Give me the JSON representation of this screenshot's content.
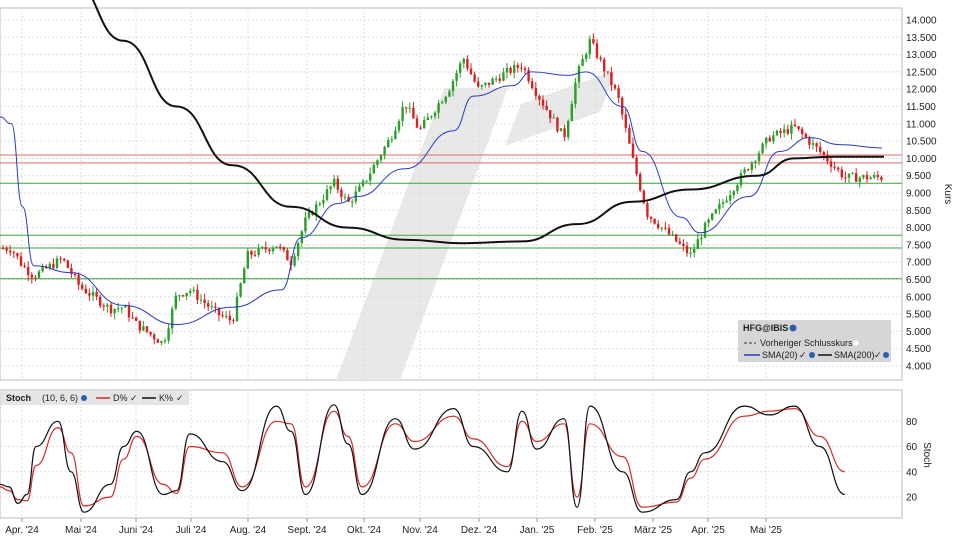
{
  "chart_data": [
    {
      "type": "candlestick",
      "instrument": "HFG@IBIS",
      "ylabel": "Kurs",
      "ylim": [
        4000,
        14000
      ],
      "yticks": [
        "14.000",
        "13.500",
        "13.000",
        "12.500",
        "12.000",
        "11.500",
        "11.000",
        "10.500",
        "10.000",
        "9.500",
        "9.000",
        "8.500",
        "8.000",
        "7.500",
        "7.000",
        "6.500",
        "6.000",
        "5.500",
        "5.000",
        "4.500",
        "4.000"
      ],
      "x_labels": [
        "Apr. '24",
        "Mai '24",
        "Juni '24",
        "Juli '24",
        "Aug. '24",
        "Sept. '24",
        "Okt. '24",
        "Nov. '24",
        "Dez. '24",
        "Jan. '25",
        "Feb. '25",
        "März '25",
        "Apr. '25",
        "Mai '25"
      ],
      "legend": [
        {
          "label": "Vorheriger Schlusskurs",
          "style": "dashed",
          "color": "#333333"
        },
        {
          "label": "SMA(20)",
          "color": "#2b3bc6"
        },
        {
          "label": "SMA(200)",
          "color": "#111111"
        }
      ],
      "horizontal_lines": [
        {
          "value": 10100,
          "color": "#e06a6a"
        },
        {
          "value": 9870,
          "color": "#e06a6a"
        },
        {
          "value": 9280,
          "color": "#3aa33a"
        },
        {
          "value": 7780,
          "color": "#3aa33a"
        },
        {
          "value": 7410,
          "color": "#3aa33a"
        },
        {
          "value": 6520,
          "color": "#3aa33a"
        }
      ],
      "price_anchors": [
        [
          "Apr. '24",
          7400
        ],
        [
          "Apr. '24",
          6900
        ],
        [
          "Apr. '24",
          6600
        ],
        [
          "Mai '24",
          7100
        ],
        [
          "Mai '24",
          6300
        ],
        [
          "Juni '24",
          5650
        ],
        [
          "Juni '24",
          5700
        ],
        [
          "Juni '24",
          5200
        ],
        [
          "Juli '24",
          4650
        ],
        [
          "Juli '24",
          6050
        ],
        [
          "Juli '24",
          6200
        ],
        [
          "Aug. '24",
          5500
        ],
        [
          "Aug. '24",
          5300
        ],
        [
          "Aug. '24",
          7200
        ],
        [
          "Sept. '24",
          7500
        ],
        [
          "Sept. '24",
          7000
        ],
        [
          "Sept. '24",
          8200
        ],
        [
          "Okt. '24",
          9300
        ],
        [
          "Okt. '24",
          8700
        ],
        [
          "Okt. '24",
          9200
        ],
        [
          "Nov. '24",
          10600
        ],
        [
          "Nov. '24",
          11600
        ],
        [
          "Nov. '24",
          10800
        ],
        [
          "Dez. '24",
          12000
        ],
        [
          "Dez. '24",
          12900
        ],
        [
          "Dez. '24",
          12000
        ],
        [
          "Jan. '25",
          12500
        ],
        [
          "Jan. '25",
          12700
        ],
        [
          "Jan. '25",
          11900
        ],
        [
          "Feb. '25",
          10600
        ],
        [
          "Feb. '25",
          12400
        ],
        [
          "Feb. '25",
          13400
        ],
        [
          "März '25",
          11800
        ],
        [
          "März '25",
          10000
        ],
        [
          "März '25",
          8400
        ],
        [
          "Apr. '25",
          7600
        ],
        [
          "Apr. '25",
          7200
        ],
        [
          "Apr. '25",
          8000
        ],
        [
          "Mai '25",
          9600
        ],
        [
          "Mai '25",
          10600
        ],
        [
          "Mai '25",
          10900
        ],
        [
          "Mai '25",
          10200
        ],
        [
          "Mai '25",
          9450
        ]
      ],
      "sma20_anchors": [
        [
          "Apr. '24",
          11000
        ],
        [
          "Apr. '24",
          8600
        ],
        [
          "Apr. '24",
          6900
        ],
        [
          "Mai '24",
          6700
        ],
        [
          "Juni '24",
          5750
        ],
        [
          "Juli '24",
          5200
        ],
        [
          "Aug. '24",
          5700
        ],
        [
          "Sept. '24",
          6200
        ],
        [
          "Sept. '24",
          7700
        ],
        [
          "Okt. '24",
          8700
        ],
        [
          "Okt. '24",
          8900
        ],
        [
          "Nov. '24",
          9700
        ],
        [
          "Dez. '24",
          10800
        ],
        [
          "Dez. '24",
          11800
        ],
        [
          "Jan. '25",
          12100
        ],
        [
          "Jan. '25",
          12500
        ],
        [
          "Feb. '25",
          12400
        ],
        [
          "Feb. '25",
          12500
        ],
        [
          "März '25",
          11500
        ],
        [
          "März '25",
          10200
        ],
        [
          "Apr. '25",
          8300
        ],
        [
          "Apr. '25",
          7850
        ],
        [
          "Mai '25",
          8900
        ],
        [
          "Mai '25",
          10200
        ],
        [
          "Mai '25",
          10600
        ],
        [
          "Mai '25",
          10400
        ]
      ],
      "sma200_anchors": [
        [
          "Mai '24",
          15200
        ],
        [
          "Juni '24",
          13400
        ],
        [
          "Juli '24",
          11500
        ],
        [
          "Aug. '24",
          9800
        ],
        [
          "Sept. '24",
          8600
        ],
        [
          "Okt. '24",
          8000
        ],
        [
          "Nov. '24",
          7650
        ],
        [
          "Dez. '24",
          7550
        ],
        [
          "Jan. '25",
          7600
        ],
        [
          "Feb. '25",
          8100
        ],
        [
          "März '25",
          8750
        ],
        [
          "Apr. '25",
          9100
        ],
        [
          "Mai '25",
          9500
        ],
        [
          "Mai '25",
          10000
        ],
        [
          "Mai '25",
          10050
        ]
      ]
    },
    {
      "type": "line",
      "indicator": "Stoch",
      "params": "(10, 6, 6)",
      "ylabel": "Stoch",
      "ylim": [
        5,
        100
      ],
      "yticks": [
        "80",
        "60",
        "40",
        "20"
      ],
      "series": [
        {
          "name": "D%",
          "color": "#d42a2a"
        },
        {
          "name": "K%",
          "color": "#111111"
        }
      ],
      "k_anchors": [
        [
          "Apr. '24",
          28
        ],
        [
          "Apr. '24",
          15
        ],
        [
          "Apr. '24",
          22
        ],
        [
          "Apr. '24",
          60
        ],
        [
          "Mai '24",
          80
        ],
        [
          "Mai '24",
          40
        ],
        [
          "Mai '24",
          8
        ],
        [
          "Juni '24",
          30
        ],
        [
          "Juni '24",
          60
        ],
        [
          "Juni '24",
          72
        ],
        [
          "Juli '24",
          22
        ],
        [
          "Juli '24",
          25
        ],
        [
          "Juli '24",
          70
        ],
        [
          "Aug. '24",
          48
        ],
        [
          "Aug. '24",
          25
        ],
        [
          "Sept. '24",
          92
        ],
        [
          "Sept. '24",
          72
        ],
        [
          "Sept. '24",
          22
        ],
        [
          "Okt. '24",
          93
        ],
        [
          "Okt. '24",
          62
        ],
        [
          "Okt. '24",
          22
        ],
        [
          "Nov. '24",
          82
        ],
        [
          "Nov. '24",
          58
        ],
        [
          "Dez. '24",
          90
        ],
        [
          "Dez. '24",
          60
        ],
        [
          "Jan. '25",
          40
        ],
        [
          "Jan. '25",
          88
        ],
        [
          "Jan. '25",
          58
        ],
        [
          "Feb. '25",
          82
        ],
        [
          "Feb. '25",
          12
        ],
        [
          "Feb. '25",
          92
        ],
        [
          "März '25",
          40
        ],
        [
          "März '25",
          8
        ],
        [
          "Apr. '25",
          18
        ],
        [
          "Apr. '25",
          40
        ],
        [
          "Apr. '25",
          55
        ],
        [
          "Mai '25",
          92
        ],
        [
          "Mai '25",
          85
        ],
        [
          "Mai '25",
          92
        ],
        [
          "Mai '25",
          60
        ],
        [
          "Mai '25",
          22
        ]
      ],
      "d_anchors": [
        [
          "Apr. '24",
          25
        ],
        [
          "Apr. '24",
          18
        ],
        [
          "Apr. '24",
          17
        ],
        [
          "Apr. '24",
          45
        ],
        [
          "Mai '24",
          75
        ],
        [
          "Mai '24",
          55
        ],
        [
          "Mai '24",
          13
        ],
        [
          "Juni '24",
          20
        ],
        [
          "Juni '24",
          50
        ],
        [
          "Juni '24",
          68
        ],
        [
          "Juli '24",
          30
        ],
        [
          "Juli '24",
          23
        ],
        [
          "Juli '24",
          60
        ],
        [
          "Aug. '24",
          55
        ],
        [
          "Aug. '24",
          28
        ],
        [
          "Sept. '24",
          80
        ],
        [
          "Sept. '24",
          78
        ],
        [
          "Sept. '24",
          28
        ],
        [
          "Okt. '24",
          88
        ],
        [
          "Okt. '24",
          68
        ],
        [
          "Okt. '24",
          28
        ],
        [
          "Nov. '24",
          78
        ],
        [
          "Nov. '24",
          64
        ],
        [
          "Dez. '24",
          84
        ],
        [
          "Dez. '24",
          66
        ],
        [
          "Jan. '25",
          44
        ],
        [
          "Jan. '25",
          80
        ],
        [
          "Jan. '25",
          64
        ],
        [
          "Feb. '25",
          78
        ],
        [
          "Feb. '25",
          20
        ],
        [
          "Feb. '25",
          78
        ],
        [
          "März '25",
          52
        ],
        [
          "März '25",
          12
        ],
        [
          "Apr. '25",
          16
        ],
        [
          "Apr. '25",
          35
        ],
        [
          "Apr. '25",
          50
        ],
        [
          "Mai '25",
          84
        ],
        [
          "Mai '25",
          88
        ],
        [
          "Mai '25",
          90
        ],
        [
          "Mai '25",
          68
        ],
        [
          "Mai '25",
          40
        ]
      ]
    }
  ]
}
